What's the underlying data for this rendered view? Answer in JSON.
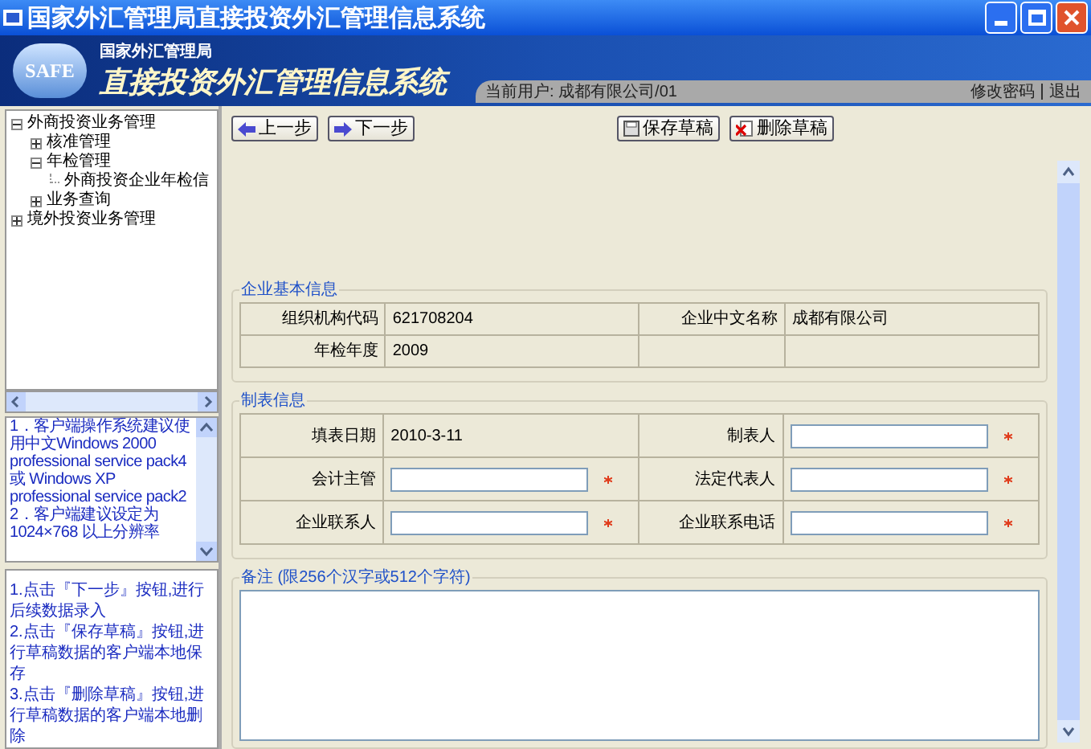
{
  "window": {
    "title": "国家外汇管理局直接投资外汇管理信息系统"
  },
  "header": {
    "logo": "SAFE",
    "org": "国家外汇管理局",
    "system": "直接投资外汇管理信息系统",
    "current_user": "当前用户: 成都有限公司/01",
    "links": [
      "修改密码",
      "退出"
    ]
  },
  "tree": [
    {
      "label": "外商投资业务管理",
      "expanded": true,
      "children": [
        {
          "label": "核准管理",
          "expanded": false
        },
        {
          "label": "年检管理",
          "expanded": true,
          "children": [
            {
              "label": "外商投资企业年检信"
            }
          ]
        },
        {
          "label": "业务查询",
          "expanded": false
        }
      ]
    },
    {
      "label": "境外投资业务管理",
      "expanded": false
    }
  ],
  "notices": [
    "1．客户端操作系统建议使用中文Windows 2000 professional service pack4 或 Windows XP professional service pack2",
    "2．客户端建议设定为 1024×768 以上分辨率"
  ],
  "instructions": [
    "1.点击『下一步』按钮,进行后续数据录入",
    "2.点击『保存草稿』按钮,进行草稿数据的客户端本地保存",
    "3.点击『删除草稿』按钮,进行草稿数据的客户端本地删除"
  ],
  "toolbar": [
    {
      "kind": "prev",
      "label": "上一步"
    },
    {
      "kind": "next",
      "label": "下一步"
    },
    {
      "kind": "save",
      "label": "保存草稿"
    },
    {
      "kind": "delete",
      "label": "删除草稿"
    }
  ],
  "basic_info": {
    "legend": "企业基本信息",
    "rows": [
      [
        {
          "label": "组织机构代码",
          "kind": "text",
          "value": "621708204"
        },
        {
          "label": "企业中文名称",
          "kind": "text",
          "value": "成都有限公司"
        }
      ],
      [
        {
          "label": "年检年度",
          "kind": "text",
          "value": "2009"
        },
        {
          "kind": "empty"
        }
      ]
    ]
  },
  "form_info": {
    "legend": "制表信息",
    "rows": [
      [
        {
          "label": "填表日期",
          "kind": "text",
          "value": "2010-3-11"
        },
        {
          "label": "制表人",
          "kind": "input",
          "required": true
        }
      ],
      [
        {
          "label": "会计主管",
          "kind": "input",
          "required": true
        },
        {
          "label": "法定代表人",
          "kind": "input",
          "required": true
        }
      ],
      [
        {
          "label": "企业联系人",
          "kind": "input",
          "required": true
        },
        {
          "label": "企业联系电话",
          "kind": "input",
          "required": true
        }
      ]
    ]
  },
  "remarks": {
    "legend": "备注 (限256个汉字或512个字符)"
  }
}
